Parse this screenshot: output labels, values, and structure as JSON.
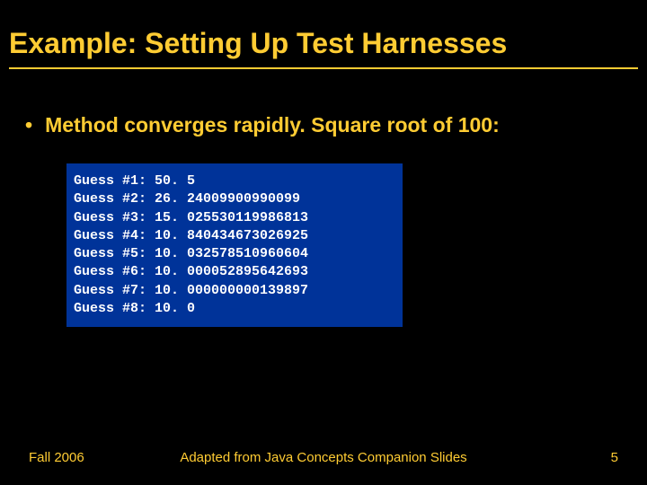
{
  "title": "Example: Setting Up Test Harnesses",
  "bullet": "Method converges rapidly. Square root of 100:",
  "code": "Guess #1: 50. 5\nGuess #2: 26. 24009900990099\nGuess #3: 15. 025530119986813\nGuess #4: 10. 840434673026925\nGuess #5: 10. 032578510960604\nGuess #6: 10. 000052895642693\nGuess #7: 10. 000000000139897\nGuess #8: 10. 0",
  "footer": {
    "left": "Fall 2006",
    "center": "Adapted from Java Concepts Companion Slides",
    "right": "5"
  }
}
